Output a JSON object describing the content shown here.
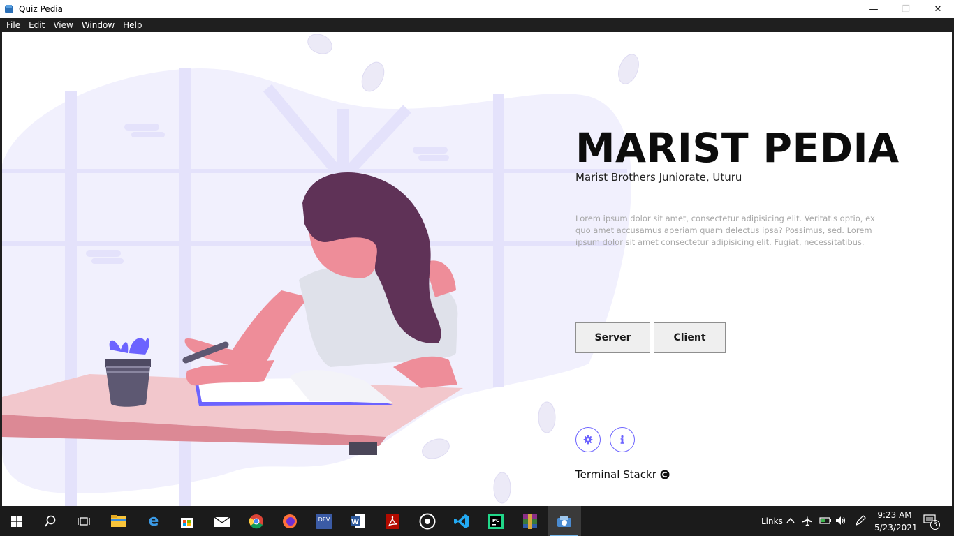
{
  "window": {
    "title": "Quiz Pedia",
    "controls": {
      "minimize": "—",
      "maximize": "❐",
      "close": "✕"
    }
  },
  "menu": [
    "File",
    "Edit",
    "View",
    "Window",
    "Help"
  ],
  "hero": {
    "title": "MARIST PEDIA",
    "subtitle": "Marist Brothers Juniorate, Uturu",
    "description": "Lorem ipsum dolor sit amet, consectetur adipisicing elit. Veritatis optio, ex quo amet accusamus aperiam quam delectus ipsa? Possimus, sed. Lorem ipsum dolor sit amet consectetur adipisicing elit. Fugiat, necessitatibus.",
    "buttons": {
      "server": "Server",
      "client": "Client"
    },
    "icon_buttons": [
      "gear-icon",
      "info-icon"
    ],
    "footer": "Terminal Stackr"
  },
  "colors": {
    "accent": "#6c63ff",
    "blob": "#f1f0fd",
    "hair": "#5f3257",
    "skin": "#ee8d99",
    "desk": "#f2c7cc"
  },
  "taskbar": {
    "apps": [
      "start",
      "search",
      "task-view",
      "file-explorer",
      "edge",
      "store",
      "mail",
      "chrome",
      "firefox",
      "dev",
      "word",
      "acrobat",
      "obs",
      "vscode",
      "pycharm",
      "winrar",
      "quiz-pedia"
    ],
    "tray": {
      "links_label": "Links",
      "time": "9:23 AM",
      "date": "5/23/2021",
      "notifications": "3"
    }
  }
}
